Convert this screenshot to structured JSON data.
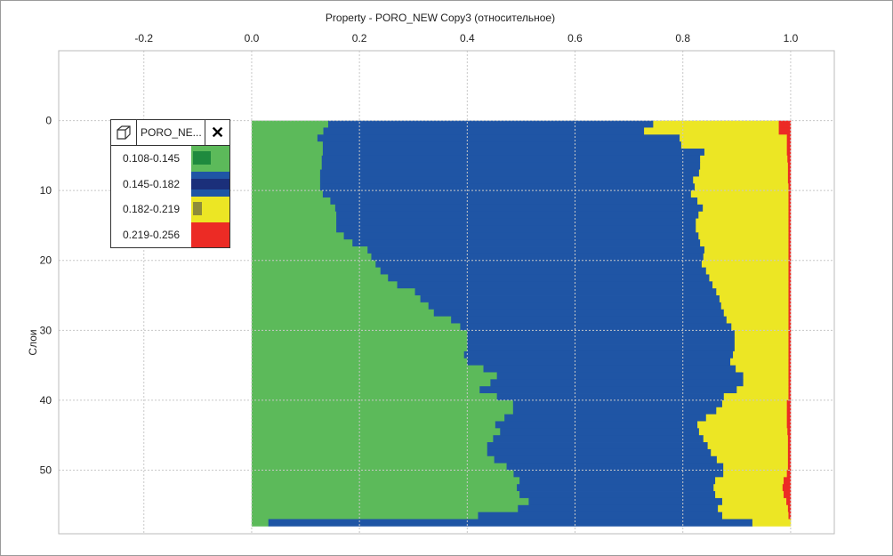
{
  "chart_data": {
    "type": "bar",
    "orientation": "horizontal-stacked-cumulative",
    "title": "Property - PORO_NEW Copy3 (относительное)",
    "xlabel": "",
    "ylabel": "Слои",
    "xlim": [
      -0.358,
      1.081
    ],
    "ylim": [
      -10,
      59.1
    ],
    "x_ticks": [
      "-0.2",
      "0.0",
      "0.2",
      "0.4",
      "0.6",
      "0.8",
      "1.0"
    ],
    "x_tick_values": [
      -0.2,
      0,
      0.2,
      0.4,
      0.6,
      0.8,
      1.0
    ],
    "y_ticks": [
      "0",
      "10",
      "20",
      "30",
      "40",
      "50"
    ],
    "y_tick_values": [
      0,
      10,
      20,
      30,
      40,
      50
    ],
    "grid": true,
    "legend_position": "top-left",
    "layers": 58,
    "series": [
      {
        "name": "0.108-0.145",
        "color": "#5cba5a",
        "marker": "#1f8a3e",
        "cum_end": [
          0.142,
          0.133,
          0.122,
          0.132,
          0.132,
          0.13,
          0.13,
          0.127,
          0.127,
          0.127,
          0.132,
          0.146,
          0.155,
          0.157,
          0.157,
          0.157,
          0.171,
          0.187,
          0.215,
          0.222,
          0.23,
          0.239,
          0.253,
          0.27,
          0.303,
          0.313,
          0.328,
          0.338,
          0.37,
          0.387,
          0.4,
          0.4,
          0.4,
          0.394,
          0.4,
          0.43,
          0.455,
          0.443,
          0.423,
          0.455,
          0.485,
          0.485,
          0.469,
          0.452,
          0.461,
          0.448,
          0.437,
          0.437,
          0.45,
          0.473,
          0.486,
          0.497,
          0.492,
          0.497,
          0.514,
          0.494,
          0.42,
          0.031
        ]
      },
      {
        "name": "0.145-0.182",
        "color": "#1f55a5",
        "marker": "#1b2f7a",
        "cum_end": [
          0.745,
          0.728,
          0.794,
          0.797,
          0.84,
          0.832,
          0.832,
          0.83,
          0.819,
          0.822,
          0.815,
          0.827,
          0.837,
          0.829,
          0.824,
          0.824,
          0.829,
          0.832,
          0.84,
          0.838,
          0.835,
          0.843,
          0.849,
          0.855,
          0.862,
          0.868,
          0.871,
          0.876,
          0.881,
          0.89,
          0.896,
          0.896,
          0.896,
          0.893,
          0.888,
          0.898,
          0.912,
          0.912,
          0.9,
          0.876,
          0.873,
          0.862,
          0.843,
          0.827,
          0.83,
          0.838,
          0.846,
          0.852,
          0.863,
          0.875,
          0.875,
          0.86,
          0.857,
          0.86,
          0.873,
          0.865,
          0.873,
          0.929
        ]
      },
      {
        "name": "0.182-0.219",
        "color": "#ece624",
        "marker": "#8e8c3a",
        "cum_end": [
          0.978,
          0.978,
          0.993,
          0.993,
          0.993,
          0.994,
          0.995,
          0.995,
          0.995,
          0.996,
          0.996,
          0.996,
          0.996,
          0.996,
          0.996,
          0.996,
          0.996,
          0.996,
          0.996,
          0.996,
          0.996,
          0.996,
          0.996,
          0.996,
          0.996,
          0.996,
          0.996,
          0.996,
          0.996,
          0.996,
          0.996,
          0.996,
          0.996,
          0.996,
          0.996,
          0.996,
          0.996,
          0.996,
          0.996,
          0.996,
          0.993,
          0.993,
          0.993,
          0.993,
          0.994,
          0.995,
          0.995,
          0.995,
          0.995,
          0.995,
          0.993,
          0.987,
          0.985,
          0.987,
          0.992,
          0.995,
          0.996,
          1.0
        ]
      },
      {
        "name": "0.219-0.256",
        "color": "#ec2b25",
        "marker": "#ec2b25",
        "cum_end": [
          1,
          1,
          1,
          1,
          1,
          1,
          1,
          1,
          1,
          1,
          1,
          1,
          1,
          1,
          1,
          1,
          1,
          1,
          1,
          1,
          1,
          1,
          1,
          1,
          1,
          1,
          1,
          1,
          1,
          1,
          1,
          1,
          1,
          1,
          1,
          1,
          1,
          1,
          1,
          1,
          1,
          1,
          1,
          1,
          1,
          1,
          1,
          1,
          1,
          1,
          1,
          1,
          1,
          1,
          1,
          1,
          1,
          1
        ]
      }
    ]
  },
  "legend": {
    "title": "PORO_NE...",
    "close_icon": "✕"
  }
}
